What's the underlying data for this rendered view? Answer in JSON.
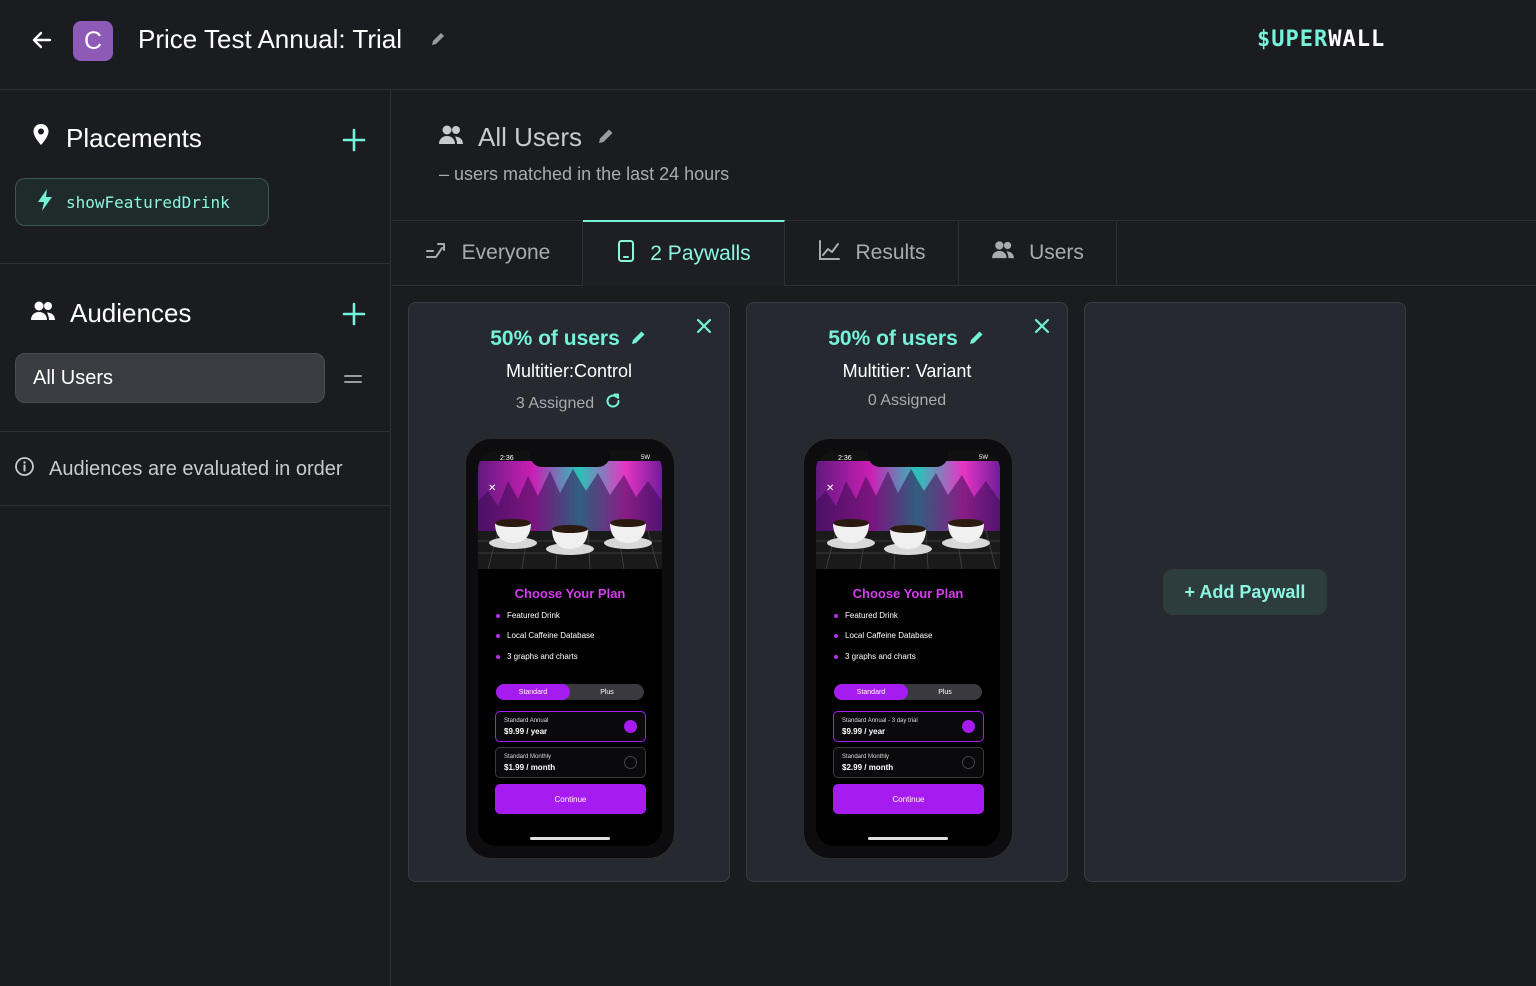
{
  "header": {
    "avatar_letter": "C",
    "title": "Price Test Annual: Trial",
    "brand_prefix": "$UPER",
    "brand_suffix": "WALL",
    "brand_color": "#74f3d9"
  },
  "sidebar": {
    "placements": {
      "heading": "Placements",
      "items": [
        {
          "label": "showFeaturedDrink",
          "icon": "bolt-icon"
        }
      ]
    },
    "audiences": {
      "heading": "Audiences",
      "items": [
        {
          "label": "All Users"
        }
      ]
    },
    "info_text": "Audiences are evaluated in order"
  },
  "main": {
    "audience_title": "All Users",
    "audience_subtitle": "– users matched in the last 24 hours",
    "tabs": [
      {
        "label": "Everyone",
        "icon": "route-icon",
        "active": false
      },
      {
        "label": "2 Paywalls",
        "icon": "tablet-icon",
        "active": true
      },
      {
        "label": "Results",
        "icon": "chart-line-icon",
        "active": false
      },
      {
        "label": "Users",
        "icon": "users-icon",
        "active": false
      }
    ],
    "paywalls": [
      {
        "percent": "50% of users",
        "name": "Multitier:Control",
        "assigned": "3 Assigned",
        "preview": {
          "time": "2:36",
          "status": "5W",
          "title": "Choose Your Plan",
          "features": [
            "Featured Drink",
            "Local Caffeine Database",
            "3 graphs and charts"
          ],
          "segments": [
            "Standard",
            "Plus"
          ],
          "options": [
            {
              "label": "Standard Annual",
              "price": "$9.99 / year",
              "selected": true
            },
            {
              "label": "Standard Monthly",
              "price": "$1.99 / month",
              "selected": false
            }
          ],
          "cta": "Continue"
        }
      },
      {
        "percent": "50% of users",
        "name": "Multitier: Variant",
        "assigned": "0 Assigned",
        "preview": {
          "time": "2:36",
          "status": "5W",
          "title": "Choose Your Plan",
          "features": [
            "Featured Drink",
            "Local Caffeine Database",
            "3 graphs and charts"
          ],
          "segments": [
            "Standard",
            "Plus"
          ],
          "options": [
            {
              "label": "Standard Annual - 3 day trial",
              "price": "$9.99 / year",
              "selected": true
            },
            {
              "label": "Standard Monthly",
              "price": "$2.99 / month",
              "selected": false
            }
          ],
          "cta": "Continue"
        }
      }
    ],
    "add_paywall_label": "+ Add Paywall"
  }
}
